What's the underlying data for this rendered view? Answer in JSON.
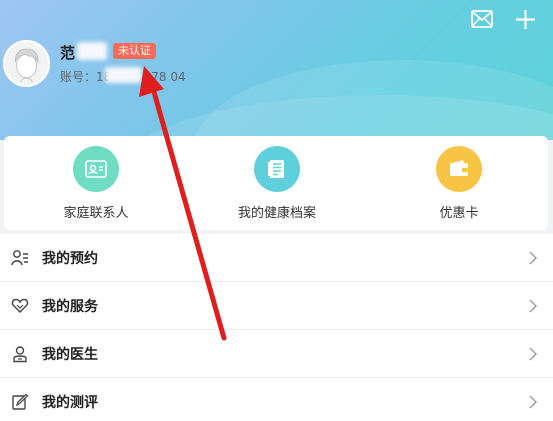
{
  "header": {
    "mail_icon": "mail-icon",
    "plus_icon": "plus-icon",
    "user_name": "范",
    "badge": "未认证",
    "account_prefix": "账号：18",
    "account_suffix": "78  04"
  },
  "quick_actions": [
    {
      "label": "家庭联系人",
      "icon": "contacts-card-icon",
      "color": "#6fdcc4"
    },
    {
      "label": "我的健康档案",
      "icon": "health-record-icon",
      "color": "#5fcfdc"
    },
    {
      "label": "优惠卡",
      "icon": "wallet-icon",
      "color": "#f8c445"
    }
  ],
  "menu": [
    {
      "label": "我的预约",
      "icon": "appointment-icon"
    },
    {
      "label": "我的服务",
      "icon": "heart-hand-icon"
    },
    {
      "label": "我的医生",
      "icon": "doctor-icon"
    },
    {
      "label": "我的测评",
      "icon": "edit-icon"
    }
  ],
  "colors": {
    "badge": "#fa6a5a",
    "annotation_arrow": "#e01e1e"
  }
}
